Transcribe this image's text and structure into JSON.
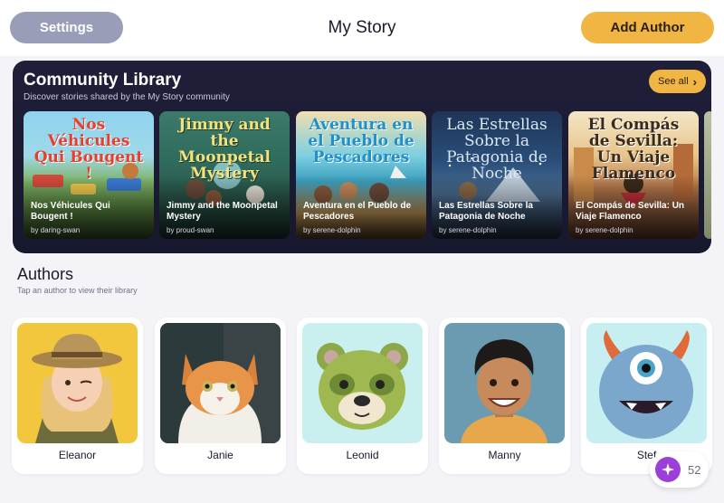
{
  "header": {
    "settings_label": "Settings",
    "title": "My Story",
    "add_author_label": "Add Author"
  },
  "library": {
    "title": "Community Library",
    "subtitle": "Discover stories shared by the My Story community",
    "see_all_label": "See all",
    "books": [
      {
        "cover_text": "Nos Véhicules Qui Bougent !",
        "title": "Nos Véhicules Qui Bougent !",
        "byline": "by daring-swan"
      },
      {
        "cover_text": "Jimmy and the Moonpetal Mystery",
        "title": "Jimmy and the Moonpetal Mystery",
        "byline": "by proud-swan"
      },
      {
        "cover_text": "Aventura en el Pueblo de Pescadores",
        "title": "Aventura en el Pueblo de Pescadores",
        "byline": "by serene-dolphin"
      },
      {
        "cover_text": "Las Estrellas Sobre la Patagonia de Noche",
        "title": "Las Estrellas Sobre la Patagonia de Noche",
        "byline": "by serene-dolphin"
      },
      {
        "cover_text": "El Compás de Sevilla: Un Viaje Flamenco",
        "title": "El Compás de Sevilla: Un Viaje Flamenco",
        "byline": "by serene-dolphin"
      }
    ]
  },
  "authors": {
    "title": "Authors",
    "subtitle": "Tap an author to view their library",
    "items": [
      {
        "name": "Eleanor"
      },
      {
        "name": "Janie"
      },
      {
        "name": "Leonid"
      },
      {
        "name": "Manny"
      },
      {
        "name": "Stef"
      }
    ]
  },
  "credits": {
    "count": "52",
    "icon": "sparkle-icon"
  },
  "colors": {
    "accent": "#f0b542",
    "settings_button": "#9a9db8",
    "library_bg": "#1f1f3a",
    "credits_icon": "#9b3fd8"
  }
}
